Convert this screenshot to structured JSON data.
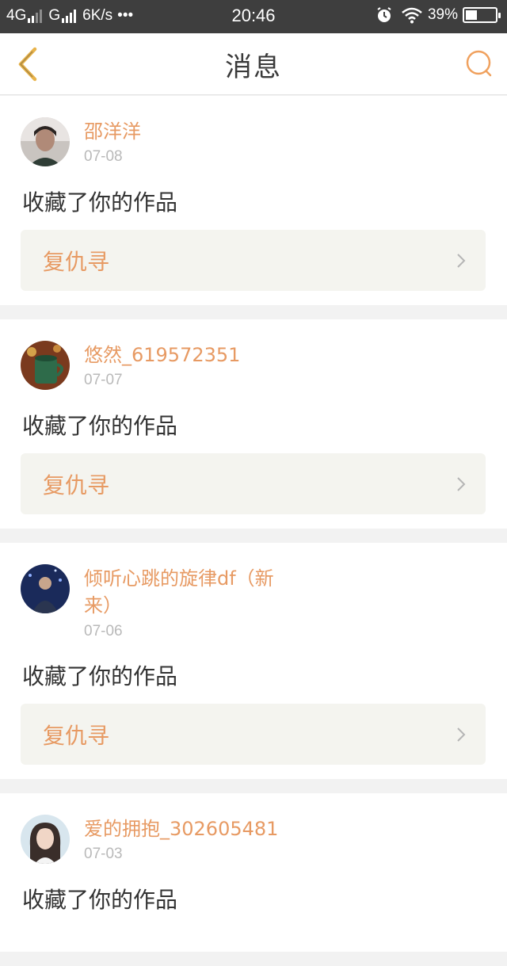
{
  "status_bar": {
    "network1": "4G",
    "network2": "G",
    "speed": "6K/s",
    "dots": "•••",
    "time": "20:46",
    "battery": "39%",
    "battery_level": 0.39,
    "icons": [
      "alarm-icon",
      "wifi-icon",
      "battery-icon"
    ]
  },
  "header": {
    "title": "消息",
    "back_icon": "chevron-left-icon",
    "search_icon": "search-icon",
    "accent_color": "#e8a24a"
  },
  "messages": [
    {
      "name": "邵洋洋",
      "date": "07-08",
      "text": "收藏了你的作品",
      "work": "复仇寻"
    },
    {
      "name": "悠然_619572351",
      "date": "07-07",
      "text": "收藏了你的作品",
      "work": "复仇寻"
    },
    {
      "name": "倾听心跳的旋律df（新来）",
      "date": "07-06",
      "text": "收藏了你的作品",
      "work": "复仇寻"
    },
    {
      "name": "爱的拥抱_302605481",
      "date": "07-03",
      "text": "收藏了你的作品",
      "work": ""
    }
  ],
  "colors": {
    "name": "#e79a63",
    "date": "#b9b9b9",
    "work_bg": "#f4f4ef"
  }
}
